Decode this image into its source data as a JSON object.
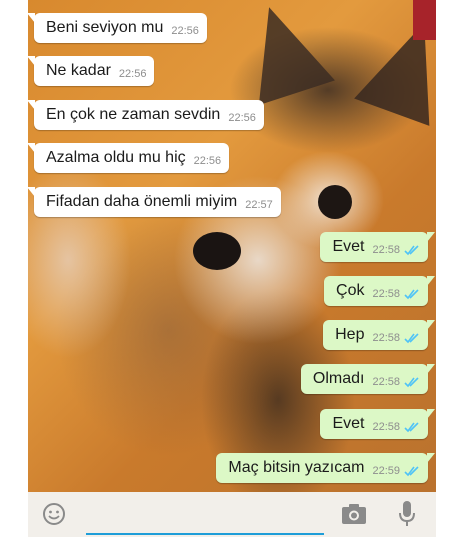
{
  "chat": {
    "incoming": [
      {
        "text": "Beni seviyon mu",
        "time": "22:56"
      },
      {
        "text": "Ne kadar",
        "time": "22:56"
      },
      {
        "text": "En çok ne zaman sevdin",
        "time": "22:56"
      },
      {
        "text": "Azalma oldu mu hiç",
        "time": "22:56"
      },
      {
        "text": "Fifadan daha önemli miyim",
        "time": "22:57"
      }
    ],
    "outgoing": [
      {
        "text": "Evet",
        "time": "22:58"
      },
      {
        "text": "Çok",
        "time": "22:58"
      },
      {
        "text": "Hep",
        "time": "22:58"
      },
      {
        "text": "Olmadı",
        "time": "22:58"
      },
      {
        "text": "Evet",
        "time": "22:58"
      },
      {
        "text": "Maç bitsin yazıcam",
        "time": "22:59"
      }
    ]
  },
  "input_bar": {
    "icons": [
      "emoji-icon",
      "camera-icon",
      "microphone-icon"
    ]
  },
  "colors": {
    "incoming_bubble": "#ffffff",
    "outgoing_bubble": "#dcf8c6",
    "read_ticks": "#4fc3f7",
    "input_underline": "#1e9dd8"
  }
}
